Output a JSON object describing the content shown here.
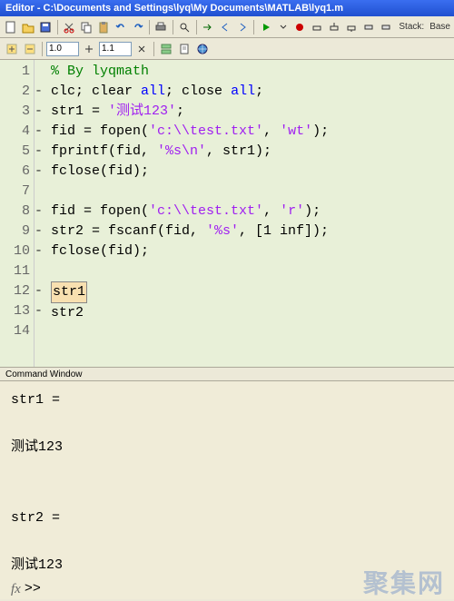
{
  "window": {
    "title": "Editor - C:\\Documents and Settings\\lyq\\My Documents\\MATLAB\\lyq1.m"
  },
  "toolbar": {
    "zoom1": "1.0",
    "zoom2": "1.1",
    "stack_label": "Stack:",
    "stack_value": "Base"
  },
  "editor": {
    "lines": [
      {
        "n": "1",
        "dash": "",
        "tokens": [
          {
            "c": "cmt",
            "t": "% By lyqmath"
          }
        ]
      },
      {
        "n": "2",
        "dash": "-",
        "tokens": [
          {
            "t": "clc; clear "
          },
          {
            "c": "kw",
            "t": "all"
          },
          {
            "t": "; close "
          },
          {
            "c": "kw",
            "t": "all"
          },
          {
            "t": ";"
          }
        ]
      },
      {
        "n": "3",
        "dash": "-",
        "tokens": [
          {
            "t": "str1 = "
          },
          {
            "c": "str",
            "t": "'测试123'"
          },
          {
            "t": ";"
          }
        ]
      },
      {
        "n": "4",
        "dash": "-",
        "tokens": [
          {
            "t": "fid = fopen("
          },
          {
            "c": "str",
            "t": "'c:\\\\test.txt'"
          },
          {
            "t": ", "
          },
          {
            "c": "str",
            "t": "'wt'"
          },
          {
            "t": ");"
          }
        ]
      },
      {
        "n": "5",
        "dash": "-",
        "tokens": [
          {
            "t": "fprintf(fid, "
          },
          {
            "c": "str",
            "t": "'%s\\n'"
          },
          {
            "t": ", str1);"
          }
        ]
      },
      {
        "n": "6",
        "dash": "-",
        "tokens": [
          {
            "t": "fclose(fid);"
          }
        ]
      },
      {
        "n": "7",
        "dash": "",
        "tokens": [
          {
            "t": " "
          }
        ]
      },
      {
        "n": "8",
        "dash": "-",
        "tokens": [
          {
            "t": "fid = fopen("
          },
          {
            "c": "str",
            "t": "'c:\\\\test.txt'"
          },
          {
            "t": ", "
          },
          {
            "c": "str",
            "t": "'r'"
          },
          {
            "t": ");"
          }
        ]
      },
      {
        "n": "9",
        "dash": "-",
        "tokens": [
          {
            "t": "str2 = fscanf(fid, "
          },
          {
            "c": "str",
            "t": "'%s'"
          },
          {
            "t": ", [1 inf]);"
          }
        ]
      },
      {
        "n": "10",
        "dash": "-",
        "tokens": [
          {
            "t": "fclose(fid);"
          }
        ]
      },
      {
        "n": "11",
        "dash": "",
        "tokens": [
          {
            "t": " "
          }
        ]
      },
      {
        "n": "12",
        "dash": "-",
        "tokens": [
          {
            "hl": true,
            "t": "str1"
          }
        ]
      },
      {
        "n": "13",
        "dash": "-",
        "tokens": [
          {
            "t": "str2"
          }
        ]
      },
      {
        "n": "14",
        "dash": "",
        "tokens": [
          {
            "t": " "
          }
        ]
      }
    ]
  },
  "cmd": {
    "title": "Command Window",
    "lines": [
      "str1 =",
      "",
      "测试123",
      "",
      "",
      "str2 =",
      "",
      "测试123"
    ],
    "prompt": ">>"
  },
  "watermark": "聚集网"
}
